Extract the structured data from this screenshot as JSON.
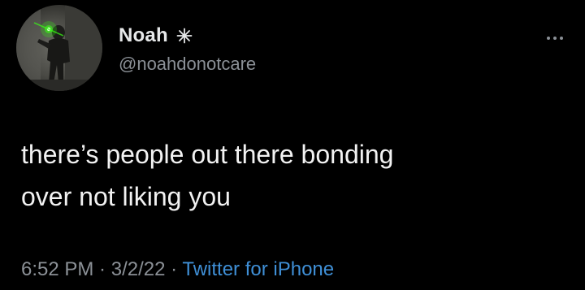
{
  "author": {
    "display_name": "Noah",
    "handle": "@noahdonotcare",
    "badge_icon": "sparkle-icon",
    "avatar_icon": "avatar-photo"
  },
  "tweet": {
    "text_line_1": "there’s people out there bonding",
    "text_line_2": "over not liking you"
  },
  "meta": {
    "time": "6:52 PM",
    "separator_1": " · ",
    "date": "3/2/22",
    "separator_2": " · ",
    "source": "Twitter for iPhone"
  },
  "actions": {
    "more_icon": "more-options-icon"
  },
  "colors": {
    "background": "#000000",
    "text": "#e7e9ea",
    "muted": "#8b9096",
    "link": "#3f8fd6",
    "accent_laser": "#39ff14"
  }
}
